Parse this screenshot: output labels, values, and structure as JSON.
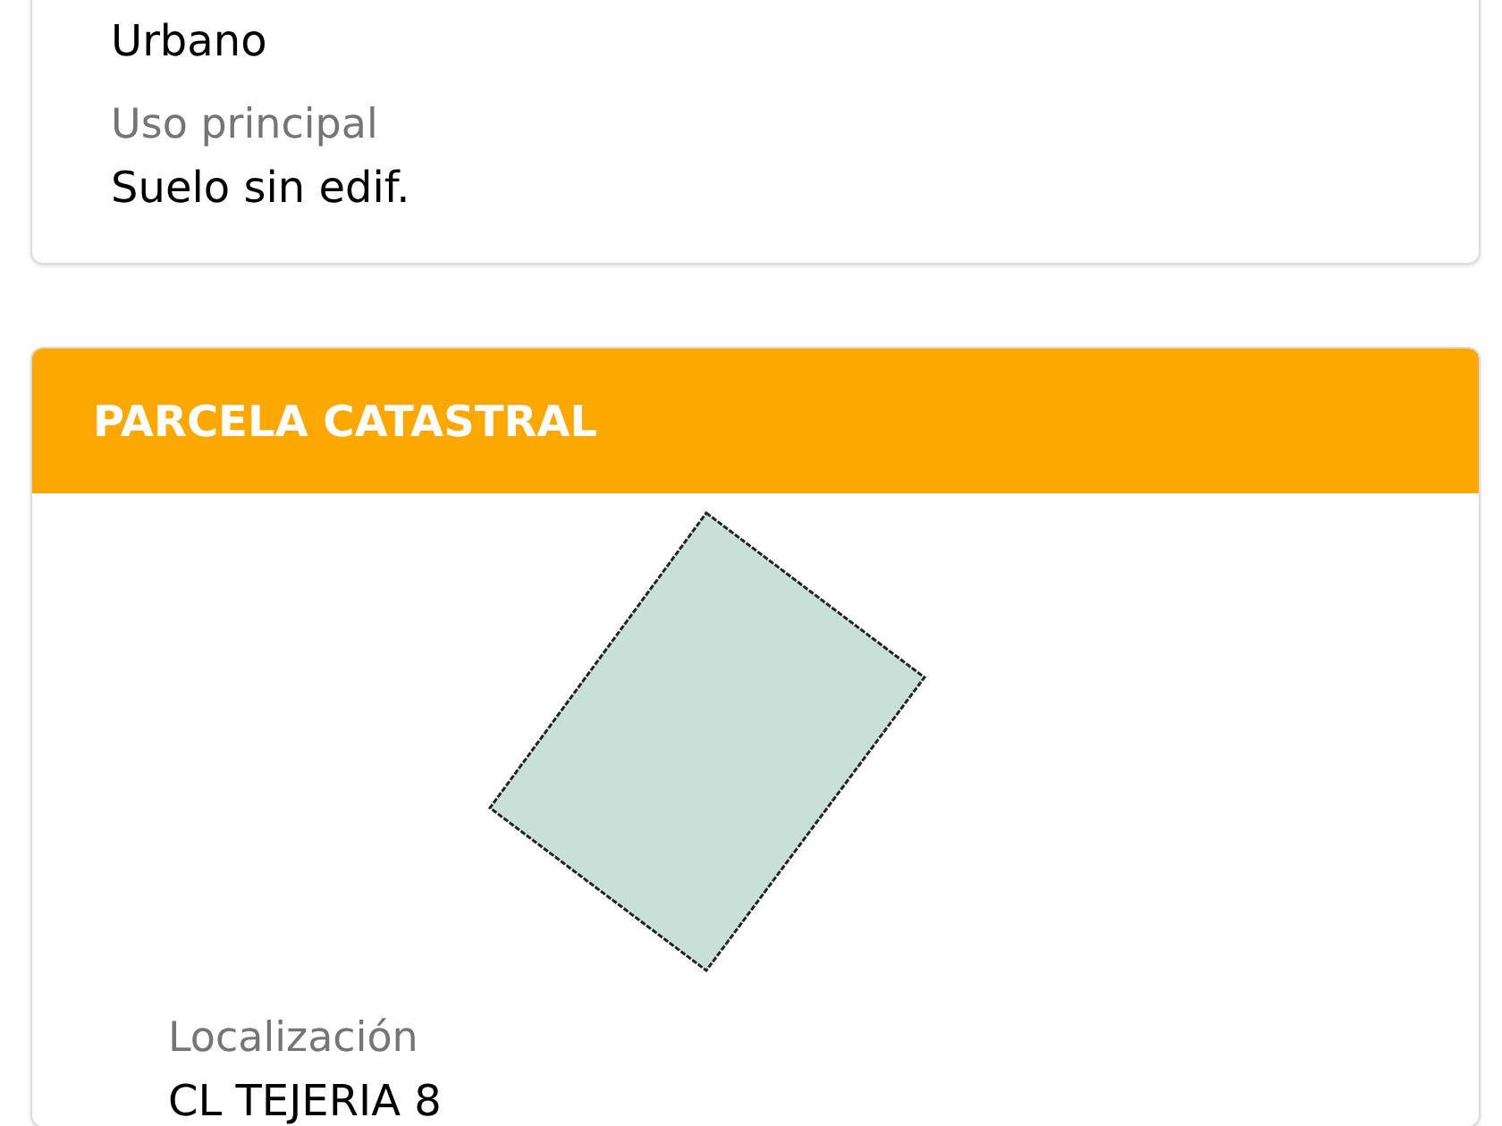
{
  "cards": [
    {
      "kind": "plain",
      "fields": [
        {
          "value": "Urbano"
        },
        {
          "label": "Uso principal",
          "value": "Suelo sin edif."
        }
      ]
    },
    {
      "kind": "parcel",
      "title": "PARCELA CATASTRAL",
      "fields": [
        {
          "label": "Localización",
          "value": "CL TEJERIA 8"
        }
      ]
    }
  ]
}
